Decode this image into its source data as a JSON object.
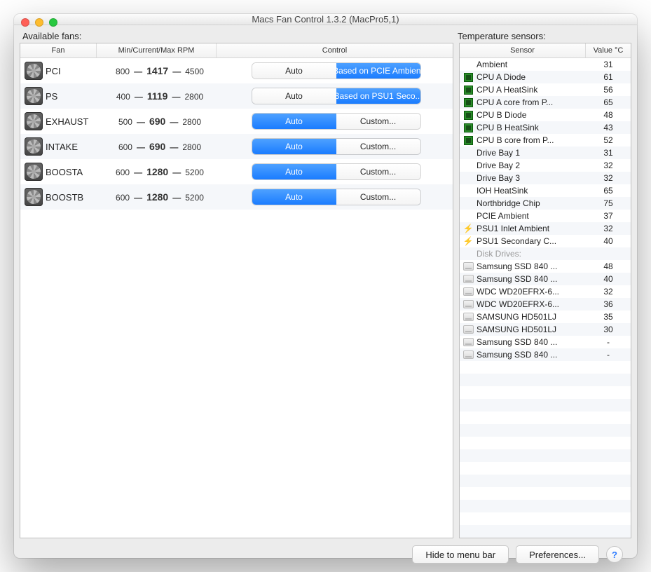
{
  "window": {
    "title": "Macs Fan Control 1.3.2 (MacPro5,1)"
  },
  "labels": {
    "fans_section": "Available fans:",
    "sensors_section": "Temperature sensors:"
  },
  "fans_table": {
    "headers": {
      "fan": "Fan",
      "rpm": "Min/Current/Max RPM",
      "control": "Control"
    },
    "auto_label": "Auto",
    "custom_label": "Custom..."
  },
  "fans": [
    {
      "name": "PCI",
      "min": "800",
      "cur": "1417",
      "max": "4500",
      "mode": "custom",
      "custom_text": "Based on PCIE Ambient"
    },
    {
      "name": "PS",
      "min": "400",
      "cur": "1119",
      "max": "2800",
      "mode": "custom",
      "custom_text": "Based on PSU1 Seco..."
    },
    {
      "name": "EXHAUST",
      "min": "500",
      "cur": "690",
      "max": "2800",
      "mode": "auto",
      "custom_text": "Custom..."
    },
    {
      "name": "INTAKE",
      "min": "600",
      "cur": "690",
      "max": "2800",
      "mode": "auto",
      "custom_text": "Custom..."
    },
    {
      "name": "BOOSTA",
      "min": "600",
      "cur": "1280",
      "max": "5200",
      "mode": "auto",
      "custom_text": "Custom..."
    },
    {
      "name": "BOOSTB",
      "min": "600",
      "cur": "1280",
      "max": "5200",
      "mode": "auto",
      "custom_text": "Custom..."
    }
  ],
  "sensors_table": {
    "headers": {
      "sensor": "Sensor",
      "value": "Value °C"
    },
    "section_disk_drives": "Disk Drives:"
  },
  "sensors": [
    {
      "icon": "none",
      "name": "Ambient",
      "value": "31"
    },
    {
      "icon": "chip",
      "name": "CPU A Diode",
      "value": "61"
    },
    {
      "icon": "chip",
      "name": "CPU A HeatSink",
      "value": "56"
    },
    {
      "icon": "chip",
      "name": "CPU A core from P...",
      "value": "65"
    },
    {
      "icon": "chip",
      "name": "CPU B Diode",
      "value": "48"
    },
    {
      "icon": "chip",
      "name": "CPU B HeatSink",
      "value": "43"
    },
    {
      "icon": "chip",
      "name": "CPU B core from P...",
      "value": "52"
    },
    {
      "icon": "none",
      "name": "Drive Bay 1",
      "value": "31"
    },
    {
      "icon": "none",
      "name": "Drive Bay 2",
      "value": "32"
    },
    {
      "icon": "none",
      "name": "Drive Bay 3",
      "value": "32"
    },
    {
      "icon": "none",
      "name": "IOH HeatSink",
      "value": "65"
    },
    {
      "icon": "none",
      "name": "Northbridge Chip",
      "value": "75"
    },
    {
      "icon": "none",
      "name": "PCIE Ambient",
      "value": "37"
    },
    {
      "icon": "bolt",
      "name": "PSU1 Inlet Ambient",
      "value": "32"
    },
    {
      "icon": "bolt",
      "name": "PSU1 Secondary C...",
      "value": "40"
    },
    {
      "section": true
    },
    {
      "icon": "drive",
      "name": "Samsung SSD 840 ...",
      "value": "48"
    },
    {
      "icon": "drive",
      "name": "Samsung SSD 840 ...",
      "value": "40"
    },
    {
      "icon": "drive",
      "name": "WDC WD20EFRX-6...",
      "value": "32"
    },
    {
      "icon": "drive",
      "name": "WDC WD20EFRX-6...",
      "value": "36"
    },
    {
      "icon": "drive",
      "name": "SAMSUNG HD501LJ",
      "value": "35"
    },
    {
      "icon": "drive",
      "name": "SAMSUNG HD501LJ",
      "value": "30"
    },
    {
      "icon": "drive",
      "name": "Samsung SSD 840 ...",
      "value": "-"
    },
    {
      "icon": "drive",
      "name": "Samsung SSD 840 ...",
      "value": "-"
    }
  ],
  "footer": {
    "hide": "Hide to menu bar",
    "prefs": "Preferences...",
    "help": "?"
  }
}
